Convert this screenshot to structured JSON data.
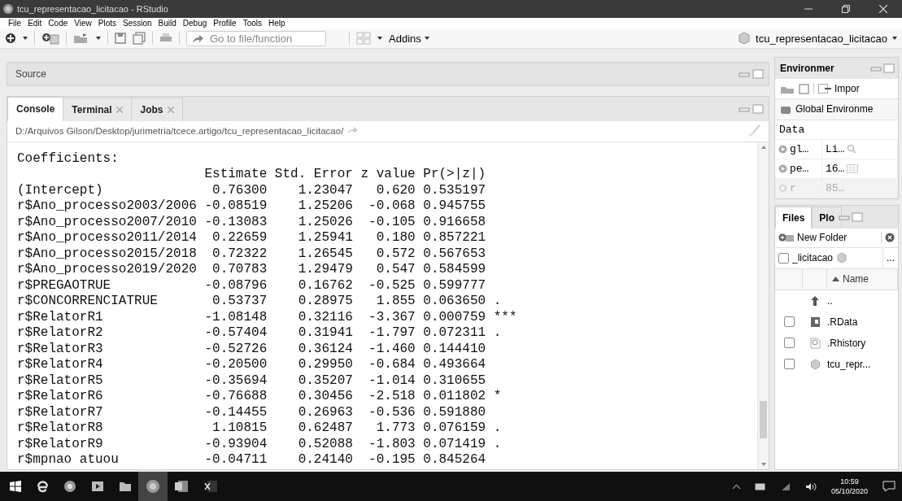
{
  "window": {
    "title": "tcu_representacao_licitacao - RStudio"
  },
  "menu": [
    "File",
    "Edit",
    "Code",
    "View",
    "Plots",
    "Session",
    "Build",
    "Debug",
    "Profile",
    "Tools",
    "Help"
  ],
  "toolbar": {
    "goto_placeholder": "Go to file/function",
    "addins": "Addins",
    "project": "tcu_representacao_licitacao"
  },
  "source_pane": {
    "title": "Source"
  },
  "console_pane": {
    "tabs": [
      {
        "label": "Console",
        "selected": true,
        "closable": false
      },
      {
        "label": "Terminal",
        "selected": false,
        "closable": true
      },
      {
        "label": "Jobs",
        "selected": false,
        "closable": true
      }
    ],
    "path": "D:/Arquivos Gilson/Desktop/jurimetria/tcece.artigo/tcu_representacao_licitacao/",
    "lines": [
      "Coefficients:",
      "                        Estimate Std. Error z value Pr(>|z|)    ",
      "(Intercept)              0.76300    1.23047   0.620 0.535197    ",
      "r$Ano_processo2003/2006 -0.08519    1.25206  -0.068 0.945755    ",
      "r$Ano_processo2007/2010 -0.13083    1.25026  -0.105 0.916658    ",
      "r$Ano_processo2011/2014  0.22659    1.25941   0.180 0.857221    ",
      "r$Ano_processo2015/2018  0.72322    1.26545   0.572 0.567653    ",
      "r$Ano_processo2019/2020  0.70783    1.29479   0.547 0.584599    ",
      "r$PREGAOTRUE            -0.08796    0.16762  -0.525 0.599777    ",
      "r$CONCORRENCIATRUE       0.53737    0.28975   1.855 0.063650 .  ",
      "r$RelatorR1             -1.08148    0.32116  -3.367 0.000759 ***",
      "r$RelatorR2             -0.57404    0.31941  -1.797 0.072311 .  ",
      "r$RelatorR3             -0.52726    0.36124  -1.460 0.144410    ",
      "r$RelatorR4             -0.20500    0.29950  -0.684 0.493664    ",
      "r$RelatorR5             -0.35694    0.35207  -1.014 0.310655    ",
      "r$RelatorR6             -0.76688    0.30456  -2.518 0.011802 *  ",
      "r$RelatorR7             -0.14455    0.26963  -0.536 0.591880    ",
      "r$RelatorR8              1.10815    0.62487   1.773 0.076159 .  ",
      "r$RelatorR9             -0.93904    0.52088  -1.803 0.071419 .  ",
      "r$mpnao atuou           -0.04711    0.24140  -0.195 0.845264    "
    ]
  },
  "environment_pane": {
    "tab": "Environmer",
    "import": "Impor",
    "scope": "Global Environme",
    "section": "Data",
    "rows": [
      {
        "name": "gl…",
        "value": "Li…",
        "kind": "search"
      },
      {
        "name": "pe…",
        "value": "16…",
        "kind": "grid"
      },
      {
        "name": "r",
        "value": "85…",
        "kind": "faded"
      }
    ]
  },
  "files_pane": {
    "tabs": [
      {
        "label": "Files",
        "selected": true
      },
      {
        "label": "Plo",
        "selected": false
      }
    ],
    "new_folder": "New Folder",
    "breadcrumb": {
      "label": "_licitacao",
      "checked": false
    },
    "more": "...",
    "sort_column": "Name",
    "files": [
      {
        "name": "..",
        "kind": "up"
      },
      {
        "name": ".RData",
        "kind": "rdata",
        "checked": false
      },
      {
        "name": ".Rhistory",
        "kind": "rhistory",
        "checked": false
      },
      {
        "name": "tcu_repr...",
        "kind": "rproj",
        "checked": false
      }
    ]
  },
  "taskbar": {
    "time": "10:59",
    "date": "05/10/2020"
  }
}
